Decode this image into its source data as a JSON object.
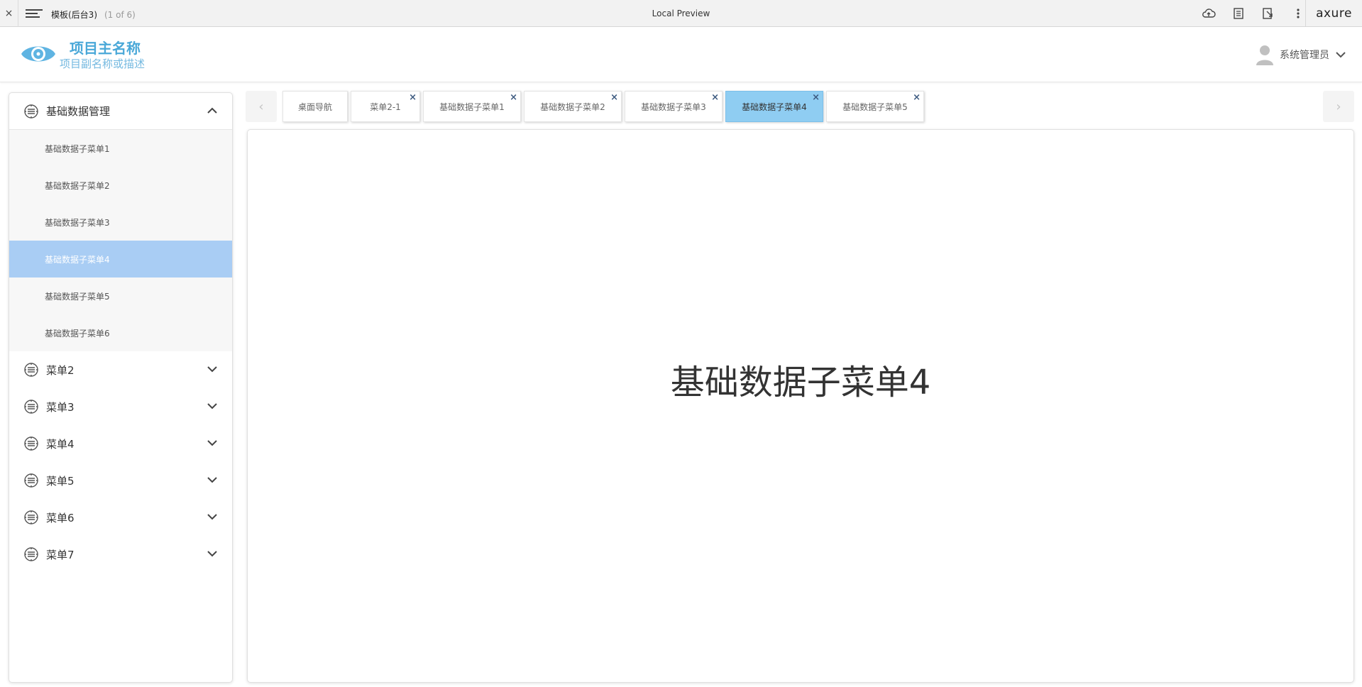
{
  "preview_bar": {
    "close": "×",
    "page_name": "模板(后台3)",
    "page_count": "(1 of 6)",
    "center_title": "Local Preview",
    "brand": "axure"
  },
  "header": {
    "title": "项目主名称",
    "subtitle": "项目副名称或描述",
    "user_name": "系统管理员"
  },
  "sidebar": {
    "groups": [
      {
        "label": "基础数据管理",
        "expanded": true,
        "items": [
          {
            "label": "基础数据子菜单1"
          },
          {
            "label": "基础数据子菜单2"
          },
          {
            "label": "基础数据子菜单3"
          },
          {
            "label": "基础数据子菜单4",
            "active": true
          },
          {
            "label": "基础数据子菜单5"
          },
          {
            "label": "基础数据子菜单6"
          }
        ]
      },
      {
        "label": "菜单2",
        "expanded": false
      },
      {
        "label": "菜单3",
        "expanded": false
      },
      {
        "label": "菜单4",
        "expanded": false
      },
      {
        "label": "菜单5",
        "expanded": false
      },
      {
        "label": "菜单6",
        "expanded": false
      },
      {
        "label": "菜单7",
        "expanded": false
      }
    ]
  },
  "tabs": [
    {
      "label": "桌面导航",
      "closable": false
    },
    {
      "label": "菜单2-1",
      "closable": true
    },
    {
      "label": "基础数据子菜单1",
      "closable": true
    },
    {
      "label": "基础数据子菜单2",
      "closable": true
    },
    {
      "label": "基础数据子菜单3",
      "closable": true
    },
    {
      "label": "基础数据子菜单4",
      "closable": true,
      "active": true
    },
    {
      "label": "基础数据子菜单5",
      "closable": true
    }
  ],
  "tab_close_glyph": "×",
  "tab_nav": {
    "prev": "‹",
    "next": "›"
  },
  "content": {
    "title": "基础数据子菜单4"
  },
  "colors": {
    "accent_blue": "#4aa8d8",
    "active_submenu": "#a9cdf4",
    "active_tab": "#8fcdf2"
  },
  "icons": {
    "logo": "eye-logo-icon",
    "menu_group": "layers-circle-icon",
    "user": "user-avatar-icon"
  }
}
